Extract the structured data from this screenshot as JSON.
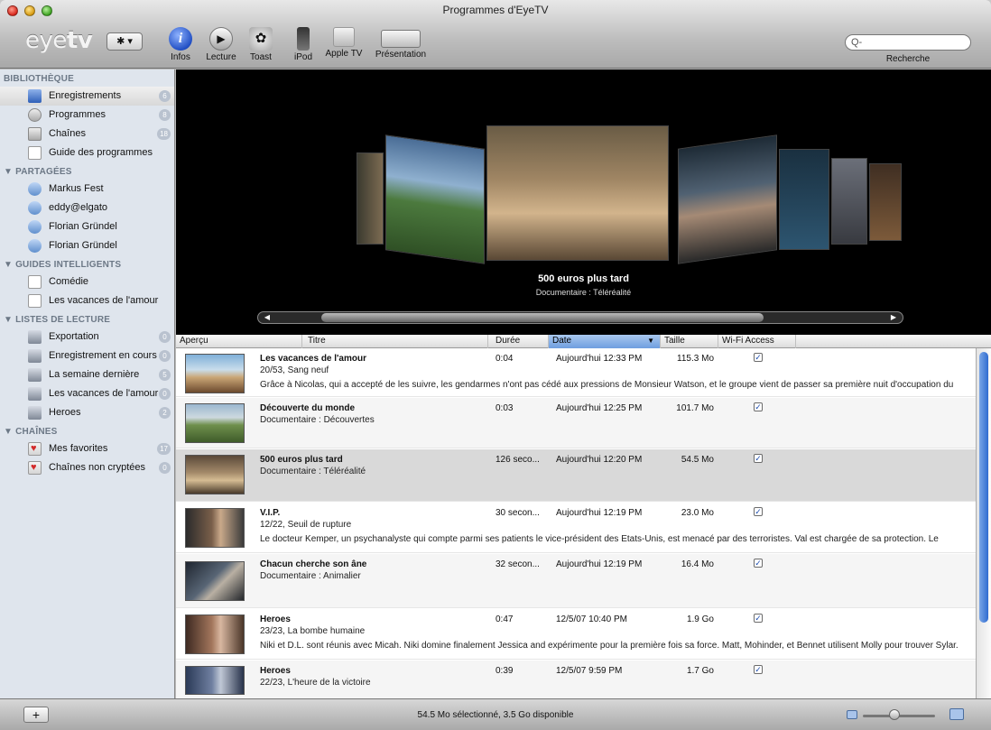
{
  "window": {
    "title": "Programmes d'EyeTV"
  },
  "toolbar": {
    "logo_light": "eye",
    "logo_bold": "tv",
    "gear_label": "✱ ▾",
    "tools": [
      {
        "label": "Infos",
        "icon": "info-icon"
      },
      {
        "label": "Lecture",
        "icon": "play-icon"
      },
      {
        "label": "Toast",
        "icon": "toast-icon"
      },
      {
        "label": "iPod",
        "icon": "ipod-icon"
      },
      {
        "label": "Apple TV",
        "icon": "apple-tv-icon"
      },
      {
        "label": "Présentation",
        "icon": "presentation-icon"
      }
    ],
    "search_placeholder": "Q-",
    "search_label": "Recherche"
  },
  "sidebar": {
    "sections": [
      {
        "title": "BIBLIOTHÈQUE",
        "items": [
          {
            "label": "Enregistrements",
            "icon": "film-icon",
            "count": "6",
            "selected": true
          },
          {
            "label": "Programmes",
            "icon": "clock-icon",
            "count": "8"
          },
          {
            "label": "Chaînes",
            "icon": "antenna-icon",
            "count": "18"
          },
          {
            "label": "Guide des programmes",
            "icon": "guide-icon"
          }
        ]
      },
      {
        "title": "▼ PARTAGÉES",
        "items": [
          {
            "label": "Markus Fest",
            "icon": "shared-icon"
          },
          {
            "label": "eddy@elgato",
            "icon": "shared-icon"
          },
          {
            "label": "Florian Gründel",
            "icon": "shared-icon"
          },
          {
            "label": "Florian Gründel",
            "icon": "shared-icon"
          }
        ]
      },
      {
        "title": "▼ GUIDES INTELLIGENTS",
        "items": [
          {
            "label": "Comédie",
            "icon": "smart-guide-icon"
          },
          {
            "label": "Les vacances de l'amour",
            "icon": "smart-guide-icon"
          }
        ]
      },
      {
        "title": "▼ LISTES DE LECTURE",
        "items": [
          {
            "label": "Exportation",
            "icon": "playlist-icon",
            "count": "0"
          },
          {
            "label": "Enregistrement en cours",
            "icon": "playlist-icon",
            "count": "0"
          },
          {
            "label": "La semaine dernière",
            "icon": "playlist-icon",
            "count": "5"
          },
          {
            "label": "Les vacances de l'amour",
            "icon": "playlist-icon",
            "count": "0"
          },
          {
            "label": "Heroes",
            "icon": "playlist-icon",
            "count": "2"
          }
        ]
      },
      {
        "title": "▼ CHAÎNES",
        "items": [
          {
            "label": "Mes favorites",
            "icon": "heart-icon",
            "count": "17"
          },
          {
            "label": "Chaînes non cryptées",
            "icon": "heart-icon",
            "count": "0"
          }
        ]
      }
    ]
  },
  "coverflow": {
    "title": "500 euros plus tard",
    "subtitle": "Documentaire : Téléréalité"
  },
  "list": {
    "columns": [
      "Aperçu",
      "Titre",
      "Durée",
      "Date",
      "Taille",
      "Wi-Fi Access"
    ],
    "sorted_column": "Date",
    "rows": [
      {
        "title": "Les vacances de l'amour",
        "subtitle": "20/53, Sang neuf",
        "description": "Grâce à Nicolas, qui a accepté de les suivre, les gendarmes n'ont pas cédé aux pressions de Monsieur Watson, et le groupe vient de passer sa première nuit d'occupation du",
        "duration": "0:04",
        "date": "Aujourd'hui 12:33 PM",
        "size": "115.3 Mo",
        "wifi": "✓",
        "thumb": "beach"
      },
      {
        "title": "Découverte du monde",
        "subtitle": "Documentaire : Découvertes",
        "description": "",
        "duration": "0:03",
        "date": "Aujourd'hui 12:25 PM",
        "size": "101.7 Mo",
        "wifi": "✓",
        "thumb": "nature"
      },
      {
        "title": "500 euros plus tard",
        "subtitle": "Documentaire : Téléréalité",
        "description": "",
        "duration": "126 seco...",
        "date": "Aujourd'hui 12:20 PM",
        "size": "54.5 Mo",
        "wifi": "✓",
        "thumb": "kitchen",
        "selected": true
      },
      {
        "title": "V.I.P.",
        "subtitle": "12/22, Seuil de rupture",
        "description": "Le docteur Kemper, un psychanalyste qui compte parmi ses patients le vice-président des Etats-Unis, est menacé par des terroristes. Val est chargée de sa protection. Le",
        "duration": "30 secon...",
        "date": "Aujourd'hui 12:19 PM",
        "size": "23.0 Mo",
        "wifi": "✓",
        "thumb": "portrait"
      },
      {
        "title": "Chacun cherche son âne",
        "subtitle": "Documentaire : Animalier",
        "description": "",
        "duration": "32 secon...",
        "date": "Aujourd'hui 12:19 PM",
        "size": "16.4 Mo",
        "wifi": "✓",
        "thumb": "dark"
      },
      {
        "title": "Heroes",
        "subtitle": "23/23, La bombe humaine",
        "description": "Niki et D.L. sont réunis avec Micah. Niki domine finalement Jessica and expérimente pour la première fois sa force. Matt, Mohinder, et Bennet utilisent Molly pour trouver Sylar.",
        "duration": "0:47",
        "date": "12/5/07 10:40 PM",
        "size": "1.9 Go",
        "wifi": "✓",
        "thumb": "heroes"
      },
      {
        "title": "Heroes",
        "subtitle": "22/23, L'heure de la victoire",
        "description": "",
        "duration": "0:39",
        "date": "12/5/07 9:59 PM",
        "size": "1.7 Go",
        "wifi": "✓",
        "thumb": "heroes2"
      }
    ]
  },
  "status": {
    "text": "54.5 Mo sélectionné, 3.5 Go disponible",
    "add_label": "+"
  }
}
